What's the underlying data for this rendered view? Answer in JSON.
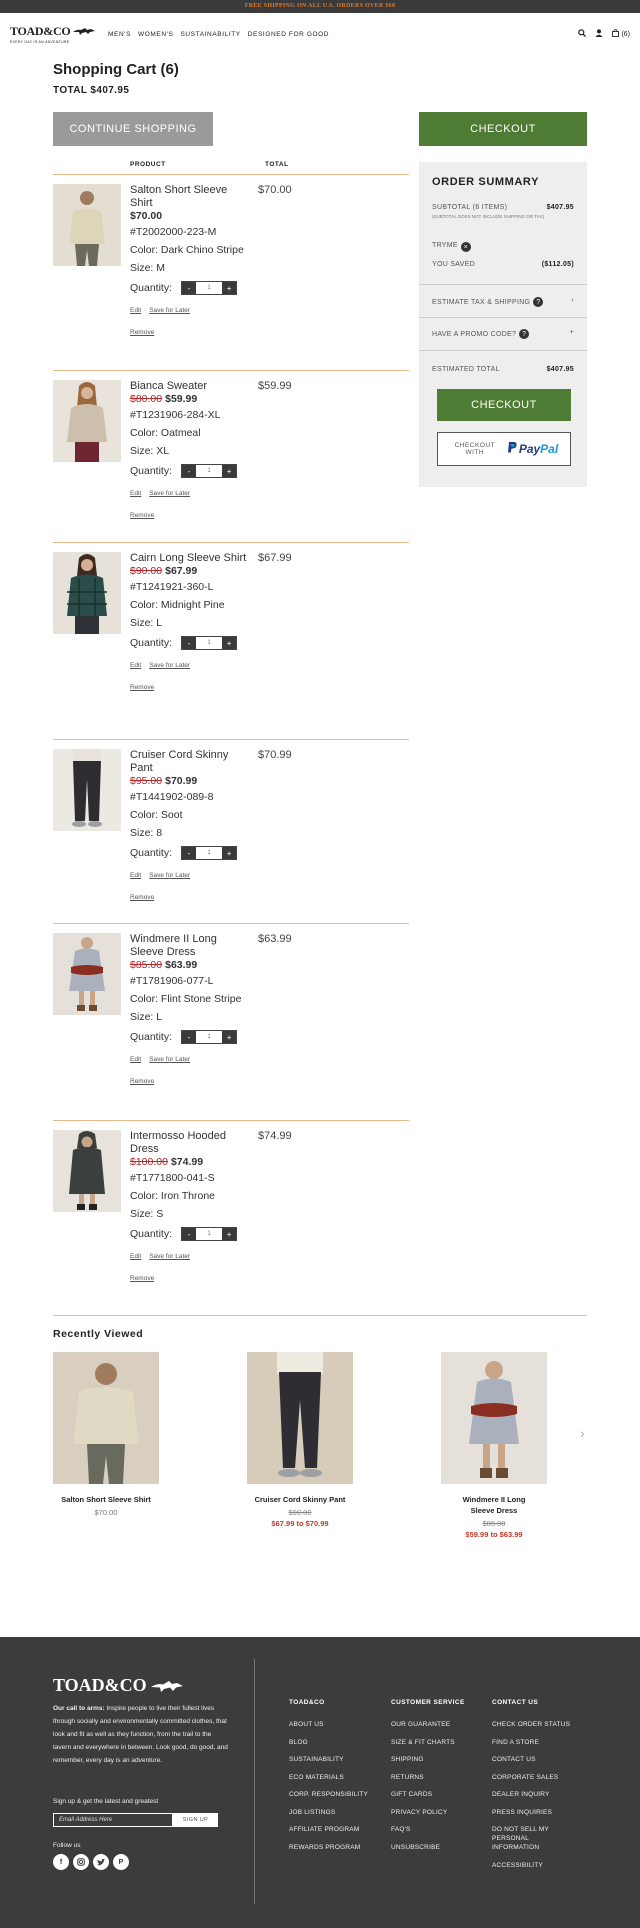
{
  "promo": "FREE SHIPPING ON ALL U.S. ORDERS OVER $60",
  "brand": {
    "name": "TOAD&CO",
    "tagline": "EVERY DAY IS AN ADVENTURE"
  },
  "nav": {
    "links": [
      "MEN'S",
      "WOMEN'S",
      "SUSTAINABILITY",
      "DESIGNED FOR GOOD"
    ],
    "cart_count": "(6)"
  },
  "cart": {
    "title": "Shopping Cart (6)",
    "total": "TOTAL $407.95",
    "continue_label": "CONTINUE SHOPPING",
    "checkout_label": "CHECKOUT",
    "col_product": "PRODUCT",
    "col_total": "TOTAL",
    "qty_label": "Quantity:",
    "qty_minus": "-",
    "qty_plus": "+",
    "edit": "Edit",
    "save_later": "Save for Later",
    "remove": "Remove",
    "items": [
      {
        "name": "Salton Short Sleeve Shirt",
        "old_price": "",
        "price": "$70.00",
        "sku": "#T2002000-223-M",
        "color": "Color: Dark Chino Stripe",
        "size": "Size: M",
        "qty": "1",
        "total": "$70.00"
      },
      {
        "name": "Bianca Sweater",
        "old_price": "$80.00",
        "price": "$59.99",
        "sku": "#T1231906-284-XL",
        "color": "Color: Oatmeal",
        "size": "Size: XL",
        "qty": "1",
        "total": "$59.99"
      },
      {
        "name": "Cairn Long Sleeve Shirt",
        "old_price": "$90.00",
        "price": "$67.99",
        "sku": "#T1241921-360-L",
        "color": "Color: Midnight Pine",
        "size": "Size: L",
        "qty": "1",
        "total": "$67.99"
      },
      {
        "name": "Cruiser Cord Skinny Pant",
        "old_price": "$95.00",
        "price": "$70.99",
        "sku": "#T1441902-089-8",
        "color": "Color: Soot",
        "size": "Size: 8",
        "qty": "1",
        "total": "$70.99"
      },
      {
        "name": "Windmere II Long Sleeve Dress",
        "old_price": "$85.00",
        "price": "$63.99",
        "sku": "#T1781906-077-L",
        "color": "Color: Flint Stone Stripe",
        "size": "Size: L",
        "qty": "1",
        "total": "$63.99"
      },
      {
        "name": "Intermosso Hooded Dress",
        "old_price": "$100.00",
        "price": "$74.99",
        "sku": "#T1771800-041-S",
        "color": "Color: Iron Throne",
        "size": "Size: S",
        "qty": "1",
        "total": "$74.99"
      }
    ]
  },
  "summary": {
    "title": "ORDER SUMMARY",
    "subtotal_label": "SUBTOTAL (6 ITEMS)",
    "subtotal_value": "$407.95",
    "subtotal_note": "(SUBTOTAL DOES NOT INCLUDE SHIPPING OR TAX)",
    "tryme": "TRYME",
    "saved_label": "YOU SAVED",
    "saved_value": "($112.05)",
    "estimate_tax": "ESTIMATE TAX & SHIPPING",
    "promo_code": "HAVE A PROMO CODE?",
    "est_total_label": "ESTIMATED TOTAL",
    "est_total_value": "$407.95",
    "checkout_label": "CHECKOUT",
    "paypal_prefix": "CHECKOUT WITH",
    "paypal_label_1": "Pay",
    "paypal_label_2": "Pal"
  },
  "recently_viewed": {
    "title": "Recently Viewed",
    "items": [
      {
        "name": "Salton Short Sleeve Shirt",
        "price": "$70.00",
        "old_price": "",
        "sale": ""
      },
      {
        "name": "Cruiser Cord Skinny Pant",
        "price": "",
        "old_price": "$90.00",
        "sale": "$67.99 to $70.99"
      },
      {
        "name": "Windmere II Long Sleeve Dress",
        "price": "",
        "old_price": "$85.00",
        "sale": "$59.99 to $63.99"
      }
    ]
  },
  "footer": {
    "call_bold": "Our call to arms:",
    "call_text": " Inspire people to live their fullest lives through socially and environmentally committed clothes, that look and fit as well as they function, from the trail to the tavern and everywhere in between. Look good, do good, and remember, every day is an adventure.",
    "signup_label": "Sign up & get the latest and greatest",
    "email_placeholder": "Email Address Here",
    "signup_btn": "SIGN UP",
    "follow": "Follow us",
    "cols": [
      {
        "head": "TOAD&CO",
        "links": [
          "ABOUT US",
          "BLOG",
          "SUSTAINABILITY",
          "ECO MATERIALS",
          "CORP. RESPONSIBILITY",
          "JOB LISTINGS",
          "AFFILIATE PROGRAM",
          "REWARDS PROGRAM"
        ]
      },
      {
        "head": "CUSTOMER SERVICE",
        "links": [
          "OUR GUARANTEE",
          "SIZE & FIT CHARTS",
          "SHIPPING",
          "RETURNS",
          "GIFT CARDS",
          "PRIVACY POLICY",
          "FAQ'S",
          "UNSUBSCRIBE"
        ]
      },
      {
        "head": "CONTACT US",
        "links": [
          "CHECK ORDER STATUS",
          "FIND A STORE",
          "CONTACT US",
          "CORPORATE SALES",
          "DEALER INQUIRY",
          "PRESS INQUIRIES",
          "DO NOT SELL MY PERSONAL INFORMATION",
          "ACCESSIBILITY"
        ]
      }
    ]
  },
  "colors": {
    "accent_green": "#4e7c34",
    "divider": "#e9b98e",
    "sale_red": "#c0392b"
  }
}
